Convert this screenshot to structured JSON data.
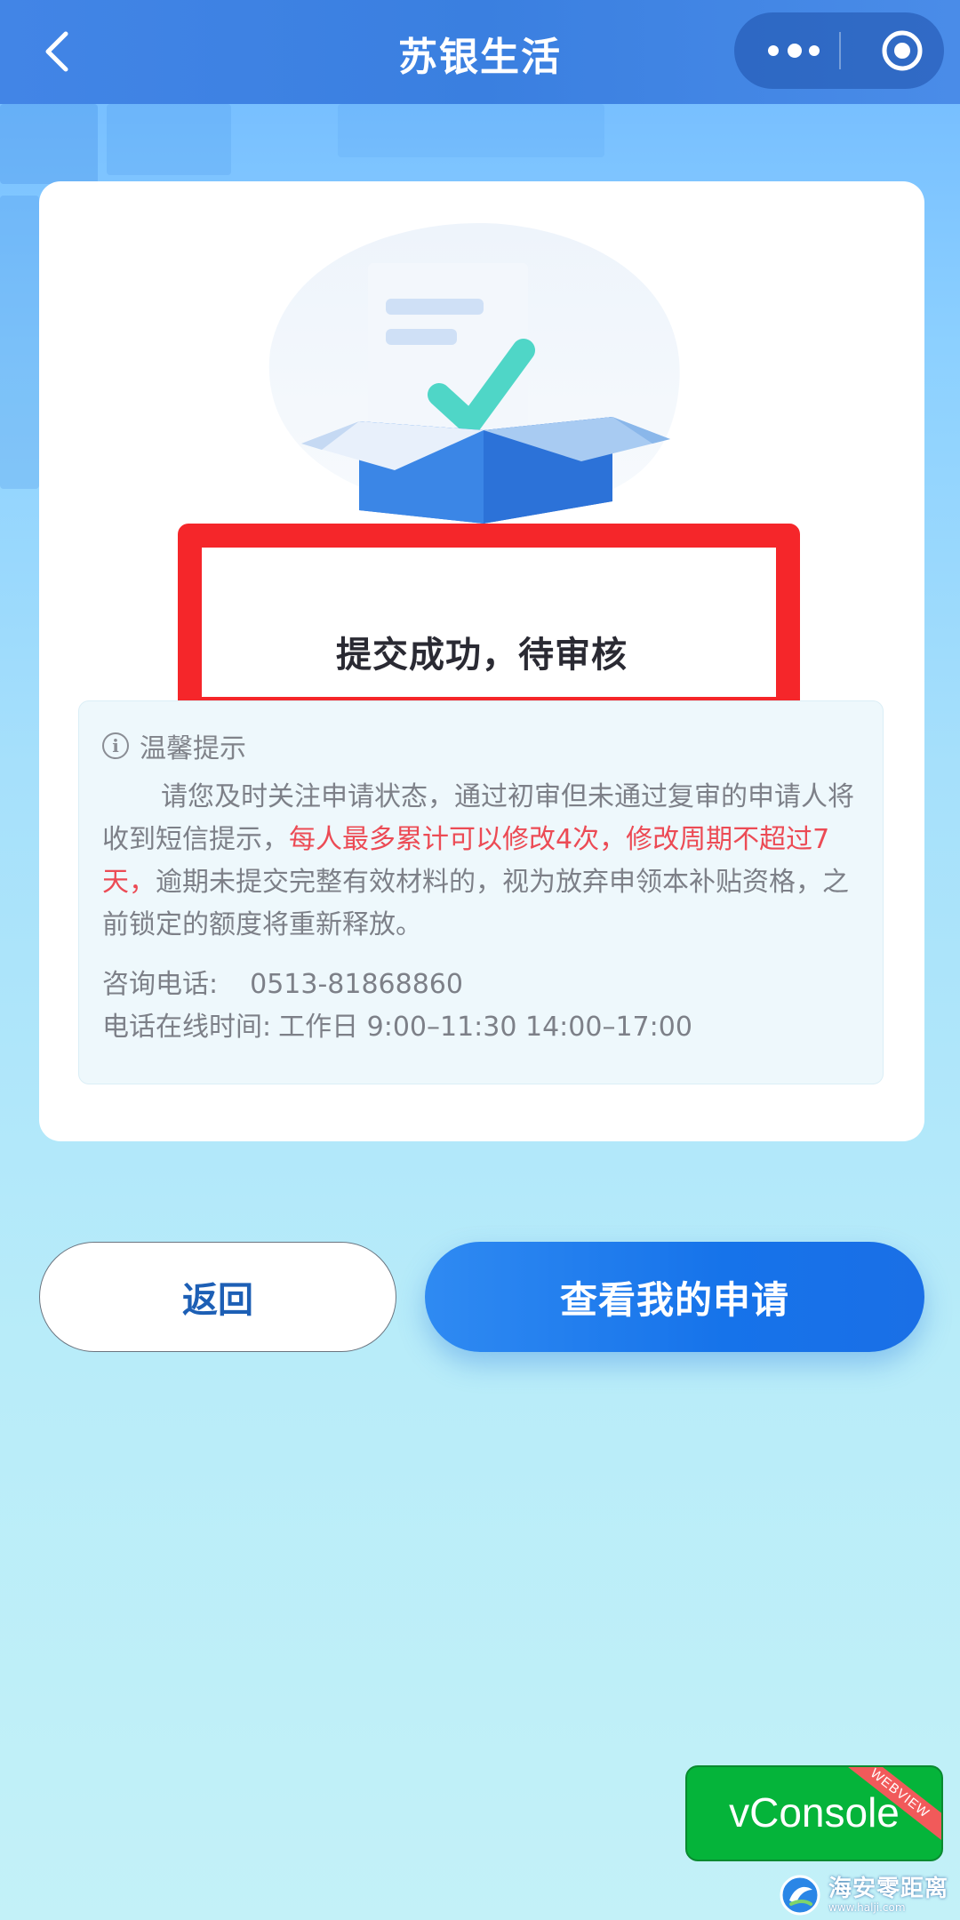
{
  "titlebar": {
    "title": "苏银生活"
  },
  "status": {
    "title": "提交成功，待审核"
  },
  "notice": {
    "heading": "温馨提示",
    "body_part1": "请您及时关注申请状态，通过初审但未通过复审的申请人将收到短信提示，",
    "body_highlight": "每人最多累计可以修改4次，修改周期不超过7天，",
    "body_part2": "逾期未提交完整有效材料的，视为放弃申领本补贴资格，之前锁定的额度将重新释放。",
    "phone_label": "咨询电话:",
    "phone_value": "0513-81868860",
    "hours_label": "电话在线时间:",
    "hours_value": "工作日 9:00–11:30 14:00–17:00"
  },
  "buttons": {
    "back_label": "返回",
    "view_label": "查看我的申请"
  },
  "vconsole": {
    "label": "vConsole",
    "ribbon": "WEBVIEW"
  },
  "watermark": {
    "title": "海安零距离",
    "url": "www.halji.com"
  },
  "colors": {
    "titlebar": "#3a7fe0",
    "highlight_border": "#f5262a",
    "notice_red": "#ec4b55",
    "primary_button": "#1673ea",
    "vconsole_green": "#05b43a"
  },
  "icons": {
    "back": "chevron-left-icon",
    "more": "more-dots-icon",
    "close": "target-circle-icon",
    "info": "info-circle-icon"
  }
}
